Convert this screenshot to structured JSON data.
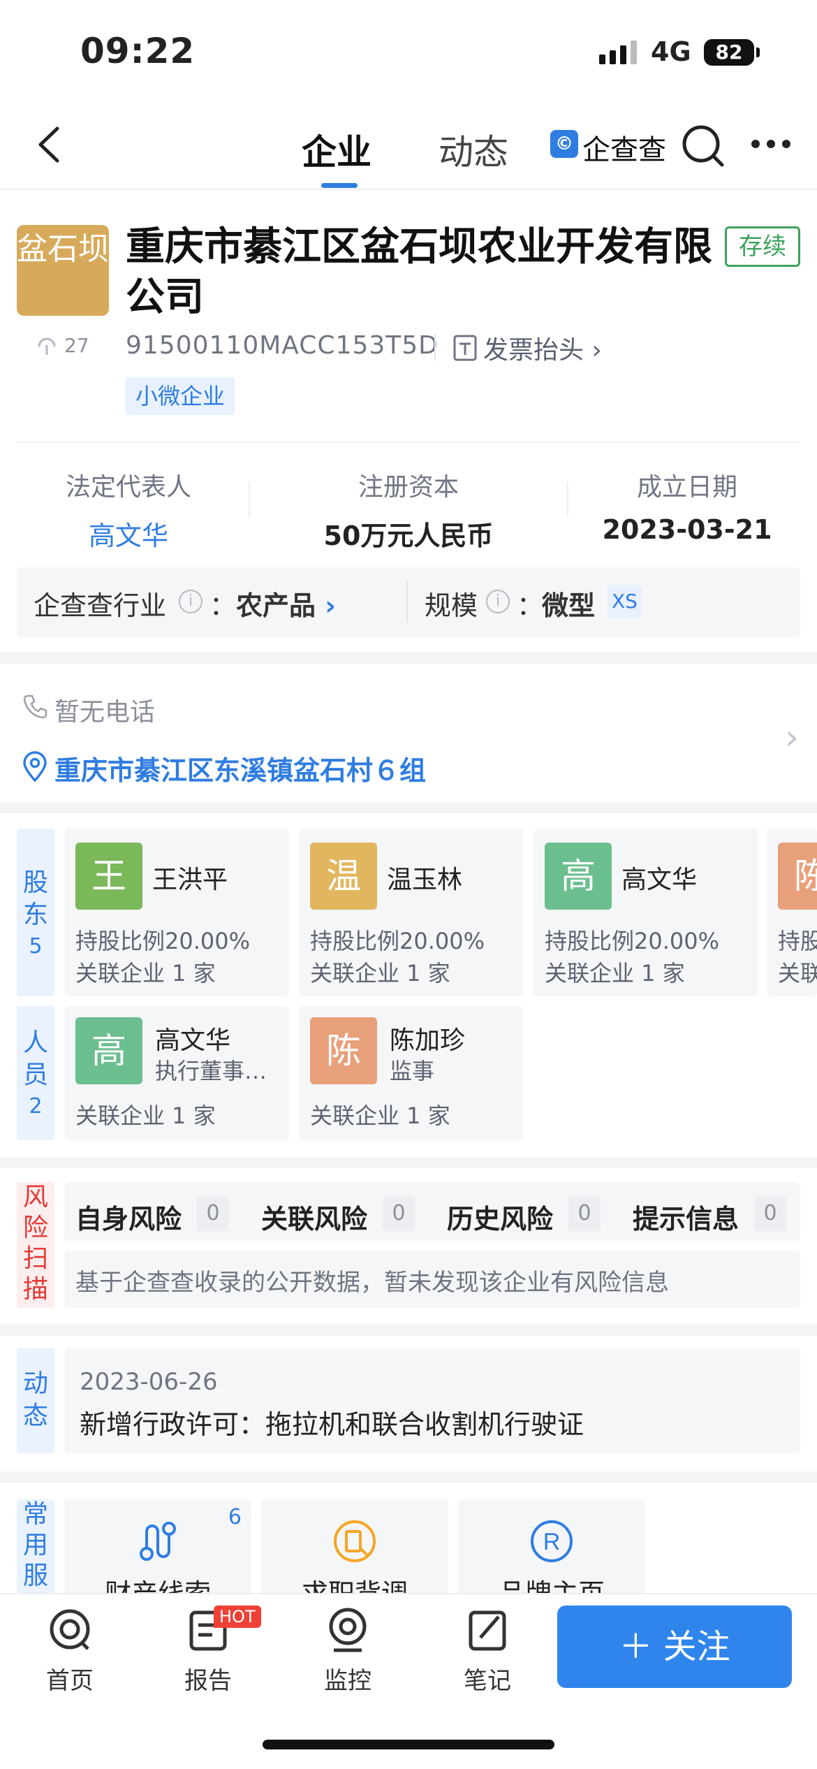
{
  "status_bar": {
    "time": "09:22",
    "network": "4G",
    "battery": "82"
  },
  "nav": {
    "tabs": [
      {
        "label": "企业"
      },
      {
        "label": "动态"
      }
    ],
    "brand": "企查查"
  },
  "company": {
    "logo_text": "盆石坝",
    "name": "重庆市綦江区盆石坝农业开发有限公司",
    "status": "存续",
    "hot_count": "27",
    "credit_code": "91500110MACC153T5D",
    "invoice_label": "发票抬头",
    "tag": "小微企业"
  },
  "info": {
    "legal_rep_label": "法定代表人",
    "legal_rep": "高文华",
    "capital_label": "注册资本",
    "capital": "50万元人民币",
    "founded_label": "成立日期",
    "founded": "2023-03-21",
    "industry_label": "企查查行业",
    "industry": "农产品",
    "scale_label": "规模",
    "scale": "微型",
    "scale_code": "XS",
    "colon": "："
  },
  "contact": {
    "phone": "暂无电话",
    "address": "重庆市綦江区东溪镇盆石村６组"
  },
  "shareholders": {
    "side_label": "股东",
    "count": "5",
    "items": [
      {
        "avatar": "王",
        "name": "王洪平",
        "ratio": "持股比例20.00%",
        "related": "关联企业 1 家",
        "color": "#7ab85a"
      },
      {
        "avatar": "温",
        "name": "温玉林",
        "ratio": "持股比例20.00%",
        "related": "关联企业 1 家",
        "color": "#e2b65e"
      },
      {
        "avatar": "高",
        "name": "高文华",
        "ratio": "持股比例20.00%",
        "related": "关联企业 1 家",
        "color": "#6bbf8e"
      },
      {
        "avatar": "陈",
        "name": "",
        "ratio": "持股",
        "related": "关联",
        "color": "#e8a07a"
      }
    ]
  },
  "personnel": {
    "side_label": "人员",
    "count": "2",
    "items": [
      {
        "avatar": "高",
        "name": "高文华",
        "role": "执行董事…",
        "related": "关联企业 1 家",
        "color": "#6bbf8e"
      },
      {
        "avatar": "陈",
        "name": "陈加珍",
        "role": "监事",
        "related": "关联企业 1 家",
        "color": "#e8a07a"
      }
    ]
  },
  "risk": {
    "side_label": "风险扫描",
    "items": [
      {
        "label": "自身风险",
        "count": "0"
      },
      {
        "label": "关联风险",
        "count": "0"
      },
      {
        "label": "历史风险",
        "count": "0"
      },
      {
        "label": "提示信息",
        "count": "0"
      }
    ],
    "description": "基于企查查收录的公开数据，暂未发现该企业有风险信息"
  },
  "news": {
    "side_label": "动态",
    "date": "2023-06-26",
    "text": "新增行政许可：拖拉机和联合收割机行驶证"
  },
  "services": {
    "side_label": "常用服",
    "items": [
      {
        "label": "财产线索",
        "badge": "6"
      },
      {
        "label": "求职背调",
        "badge": ""
      },
      {
        "label": "品牌主页",
        "badge": ""
      }
    ]
  },
  "bottom_bar": {
    "items": [
      {
        "label": "首页"
      },
      {
        "label": "报告"
      },
      {
        "label": "监控"
      },
      {
        "label": "笔记"
      }
    ],
    "hot_badge": "HOT",
    "follow_label": "＋ 关注"
  },
  "colors": {
    "accent": "#2f7de1",
    "status_green": "#3ba35b",
    "risk_red": "#e53935"
  }
}
